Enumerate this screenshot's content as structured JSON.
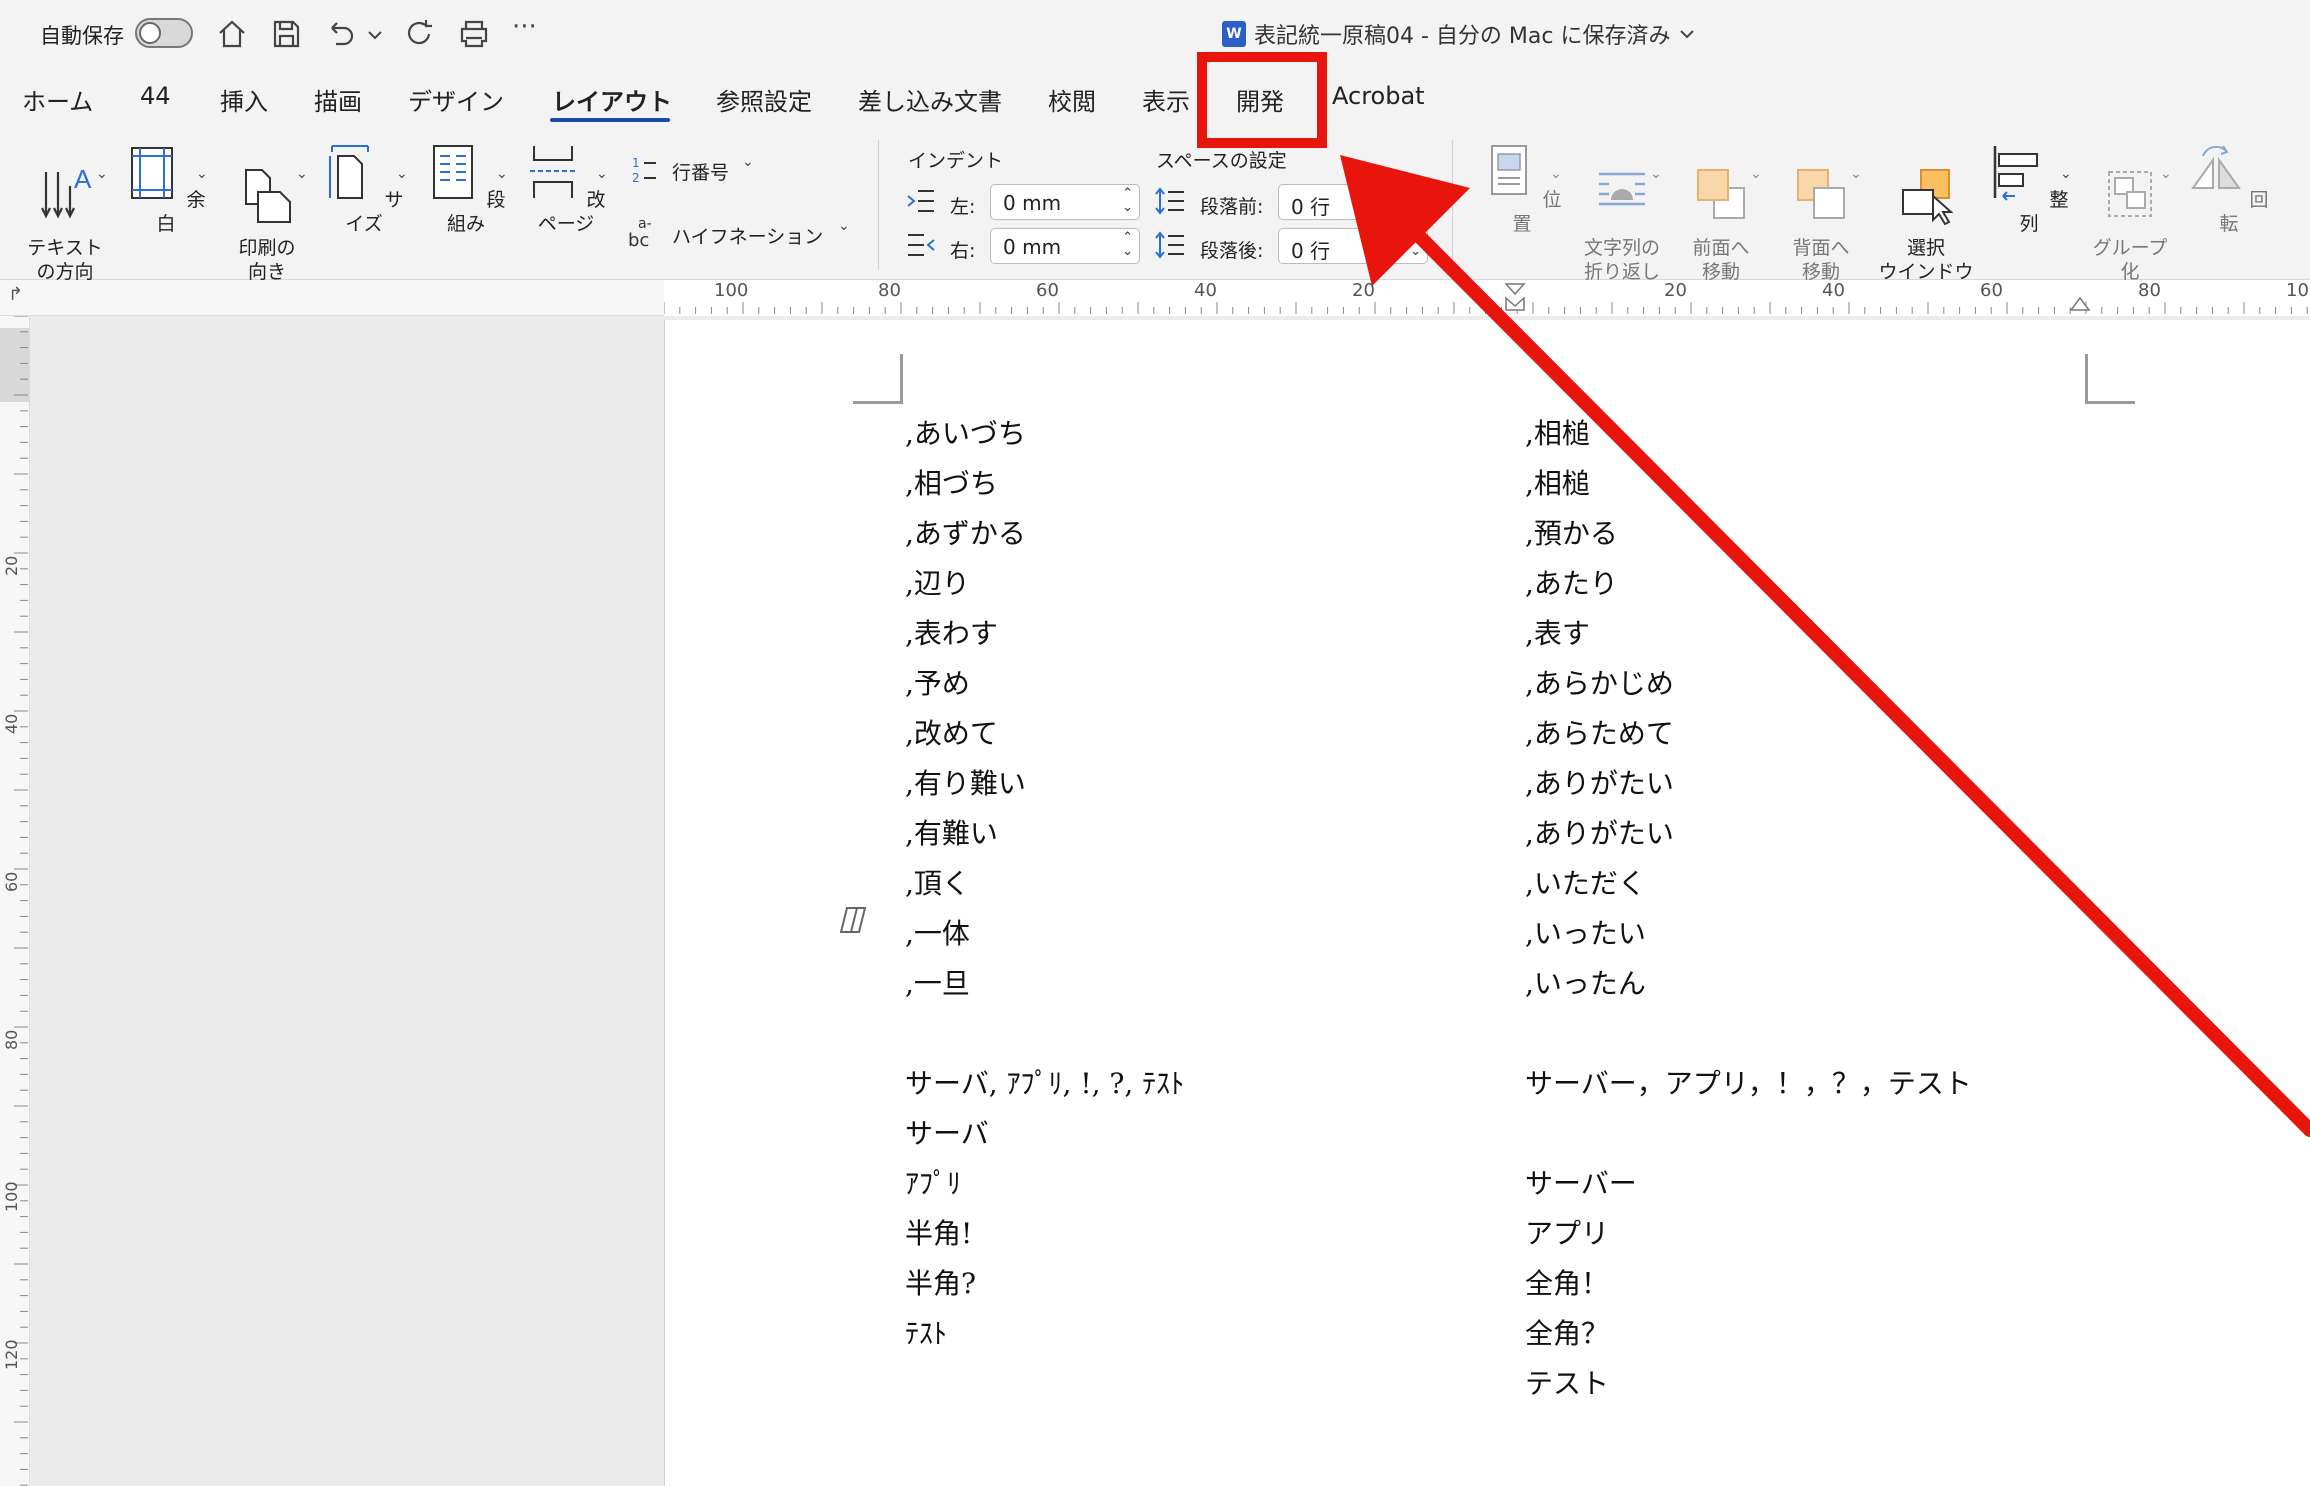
{
  "titlebar": {
    "autosave_label": "自動保存",
    "doc_title": "表記統一原稿04 - 自分の Mac に保存済み",
    "word_badge": "W",
    "more_label": "···"
  },
  "tabs": [
    {
      "label": "ホーム"
    },
    {
      "label": "44"
    },
    {
      "label": "挿入"
    },
    {
      "label": "描画"
    },
    {
      "label": "デザイン"
    },
    {
      "label": "レイアウト",
      "active": true
    },
    {
      "label": "参照設定"
    },
    {
      "label": "差し込み文書"
    },
    {
      "label": "校閲"
    },
    {
      "label": "表示"
    },
    {
      "label": "開発",
      "highlighted": true
    },
    {
      "label": "Acrobat"
    }
  ],
  "ribbon": {
    "text_direction": "テキスト\nの方向",
    "margins": "余白",
    "orientation": "印刷の\n向き",
    "size": "サイズ",
    "columns": "段組み",
    "breaks": "改ページ",
    "line_numbers": "行番号",
    "hyphenation": "ハイフネーション",
    "indent_group": "インデント",
    "indent_left_label": "左:",
    "indent_left_value": "0 mm",
    "indent_right_label": "右:",
    "indent_right_value": "0 mm",
    "spacing_group": "スペースの設定",
    "spacing_before_label": "段落前:",
    "spacing_before_value": "0 行",
    "spacing_after_label": "段落後:",
    "spacing_after_value": "0 行",
    "position": "位置",
    "wrap_text": "文字列の\n折り返し",
    "bring_forward": "前面へ\n移動",
    "send_backward": "背面へ\n移動",
    "selection_pane": "選択\nウインドウ",
    "align": "整列",
    "group": "グループ\n化",
    "rotate": "回転"
  },
  "ruler": {
    "h_labels": [
      "100",
      "80",
      "60",
      "40",
      "20",
      "20",
      "40",
      "60",
      "80",
      "10"
    ],
    "v_labels": [
      "20",
      "40",
      "60",
      "80",
      "100",
      "120"
    ]
  },
  "document": {
    "left_column": [
      ",あいづち",
      ",相づち",
      ",あずかる",
      ",辺り",
      ",表わす",
      ",予め",
      ",改めて",
      ",有り難い",
      ",有難い",
      ",頂く",
      ",一体",
      ",一旦",
      "",
      "サーバ, ｱﾌﾟﾘ, !, ?, ﾃｽﾄ",
      "サーバ",
      "ｱﾌﾟﾘ",
      "半角!",
      "半角?",
      "ﾃｽﾄ"
    ],
    "right_column": [
      ",相槌",
      ",相槌",
      ",預かる",
      ",あたり",
      ",表す",
      ",あらかじめ",
      ",あらためて",
      ",ありがたい",
      ",ありがたい",
      ",いただく",
      ",いったい",
      ",いったん",
      "",
      "サーバー，アプリ，！，？，テスト",
      "",
      "サーバー",
      "アプリ",
      "全角！",
      "全角？",
      "テスト"
    ]
  },
  "colors": {
    "highlight": "#e8150d",
    "active_tab_underline": "#1f4aa8"
  }
}
